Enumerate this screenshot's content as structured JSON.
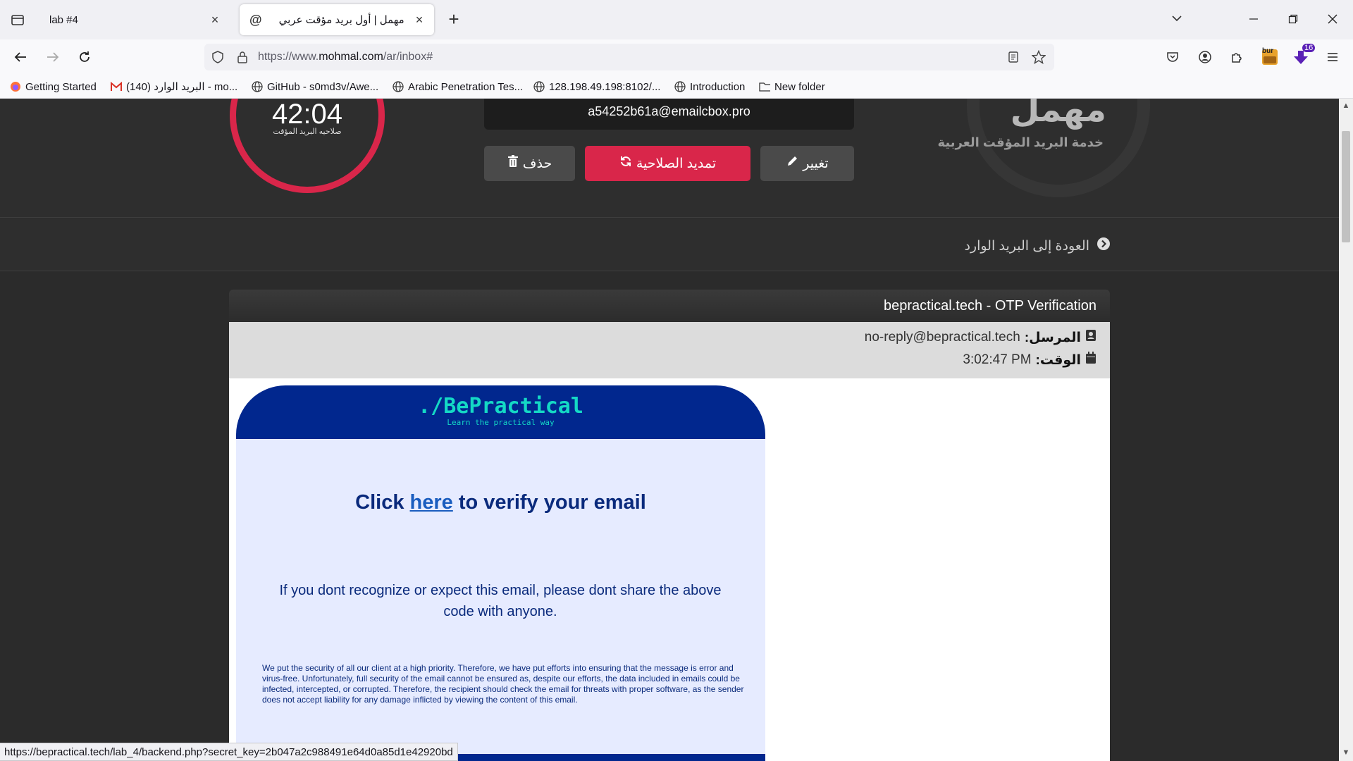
{
  "browser": {
    "tabs": [
      {
        "title": "lab #4",
        "active": false
      },
      {
        "title": "مهمل | أول بريد مؤقت عربي",
        "active": true,
        "favicon": "@"
      }
    ],
    "url_prefix": "https://www.",
    "url_domain": "mohmal.com",
    "url_path": "/ar/inbox#",
    "bookmarks": [
      {
        "label": "Getting Started",
        "icon": "firefox-icon"
      },
      {
        "label": "البريد الوارد (140) - mo...",
        "icon": "gmail-icon"
      },
      {
        "label": "GitHub - s0md3v/Awe...",
        "icon": "globe-icon"
      },
      {
        "label": "Arabic Penetration Tes...",
        "icon": "globe-icon"
      },
      {
        "label": "128.198.49.198:8102/...",
        "icon": "globe-icon"
      },
      {
        "label": "Introduction",
        "icon": "globe-icon"
      },
      {
        "label": "New folder",
        "icon": "folder-icon"
      }
    ],
    "extension_badge_bur": "bur",
    "extension_badge_count": "16",
    "status_url": "https://bepractical.tech/lab_4/backend.php?secret_key=2b047a2c988491e64d0a85d1e42920bd"
  },
  "site": {
    "timer": {
      "value": "42:04",
      "label": "صلاحيه البريد المؤقت"
    },
    "email_address": "a54252b61a@emailcbox.pro",
    "buttons": {
      "delete": "حذف",
      "extend": "تمديد الصلاحية",
      "change": "تغيير"
    },
    "logo": "مهمل",
    "logo_subtitle": "خدمة البريد المؤقت العربية",
    "back_link": "العودة إلى البريد الوارد"
  },
  "message": {
    "subject": "bepractical.tech - OTP Verification",
    "sender_label": "المرسل:",
    "sender": "no-reply@bepractical.tech",
    "time_label": "الوقت:",
    "time": "3:02:47 PM",
    "body": {
      "brand": "./BePractical",
      "tagline": "Learn the practical way",
      "heading_pre": "Click ",
      "heading_link": "here",
      "heading_post": " to verify your email",
      "paragraph": "If you dont recognize or expect this email, please dont share the above code with anyone.",
      "disclaimer": "We put the security of all our client at a high priority. Therefore, we have put efforts into ensuring that the message is error and virus-free. Unfortunately, full security of the email cannot be ensured as, despite our efforts, the data included in emails could be infected, intercepted, or corrupted. Therefore, the recipient should check the email for threats with proper software, as the sender does not accept liability for any damage inflicted by viewing the content of this email."
    }
  },
  "colors": {
    "accent_red": "#d9264a",
    "page_bg": "#2b2b2b",
    "mail_brand_blue": "#01278e",
    "mail_brand_teal": "#14d9c5"
  }
}
